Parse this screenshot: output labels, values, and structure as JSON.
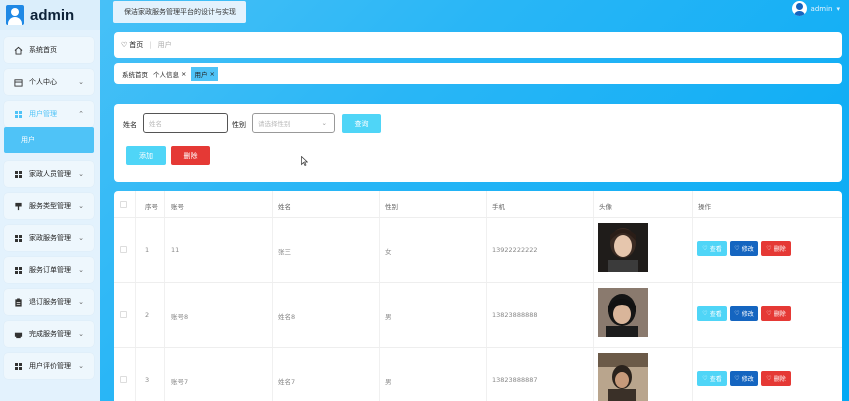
{
  "brand": {
    "title": "admin"
  },
  "app_title": "保洁家政服务管理平台的设计与实现",
  "user": {
    "name": "admin"
  },
  "sidebar": {
    "items": [
      {
        "label": "系统首页",
        "icon": "home-icon",
        "has_chevron": false
      },
      {
        "label": "个人中心",
        "icon": "calendar-icon",
        "has_chevron": true
      },
      {
        "label": "用户管理",
        "icon": "grid-icon",
        "has_chevron": true,
        "active": true
      },
      {
        "label": "家政人员管理",
        "icon": "grid-icon",
        "has_chevron": true
      },
      {
        "label": "服务类型管理",
        "icon": "pin-icon",
        "has_chevron": true
      },
      {
        "label": "家政服务管理",
        "icon": "grid-icon",
        "has_chevron": true
      },
      {
        "label": "服务订单管理",
        "icon": "grid-icon",
        "has_chevron": true
      },
      {
        "label": "退订服务管理",
        "icon": "clipboard-icon",
        "has_chevron": true
      },
      {
        "label": "完成服务管理",
        "icon": "printer-icon",
        "has_chevron": true
      },
      {
        "label": "用户评价管理",
        "icon": "grid-icon",
        "has_chevron": true
      }
    ],
    "sub_item": "用户"
  },
  "breadcrumb": {
    "home": "首页",
    "current": "用户"
  },
  "tags": [
    {
      "label": "系统首页",
      "closable": false,
      "active": false
    },
    {
      "label": "个人信息",
      "closable": true,
      "active": false
    },
    {
      "label": "用户",
      "closable": true,
      "active": true
    }
  ],
  "search": {
    "name_label": "姓名",
    "name_placeholder": "姓名",
    "gender_label": "性别",
    "gender_placeholder": "请选择性别",
    "query_button": "查询",
    "add_button": "添加",
    "delete_button": "删除"
  },
  "table": {
    "columns": [
      "序号",
      "账号",
      "姓名",
      "性别",
      "手机",
      "头像",
      "操作"
    ],
    "rows": [
      {
        "index": "1",
        "account": "11",
        "name": "张三",
        "gender": "女",
        "phone": "13922222222"
      },
      {
        "index": "2",
        "account": "账号8",
        "name": "姓名8",
        "gender": "男",
        "phone": "13823888888"
      },
      {
        "index": "3",
        "account": "账号7",
        "name": "姓名7",
        "gender": "男",
        "phone": "13823888887"
      }
    ],
    "actions": {
      "view": "查看",
      "edit": "修改",
      "delete": "删除"
    }
  },
  "colors": {
    "accent": "#4fc3f7",
    "danger": "#e53935",
    "primary": "#1565c0"
  }
}
